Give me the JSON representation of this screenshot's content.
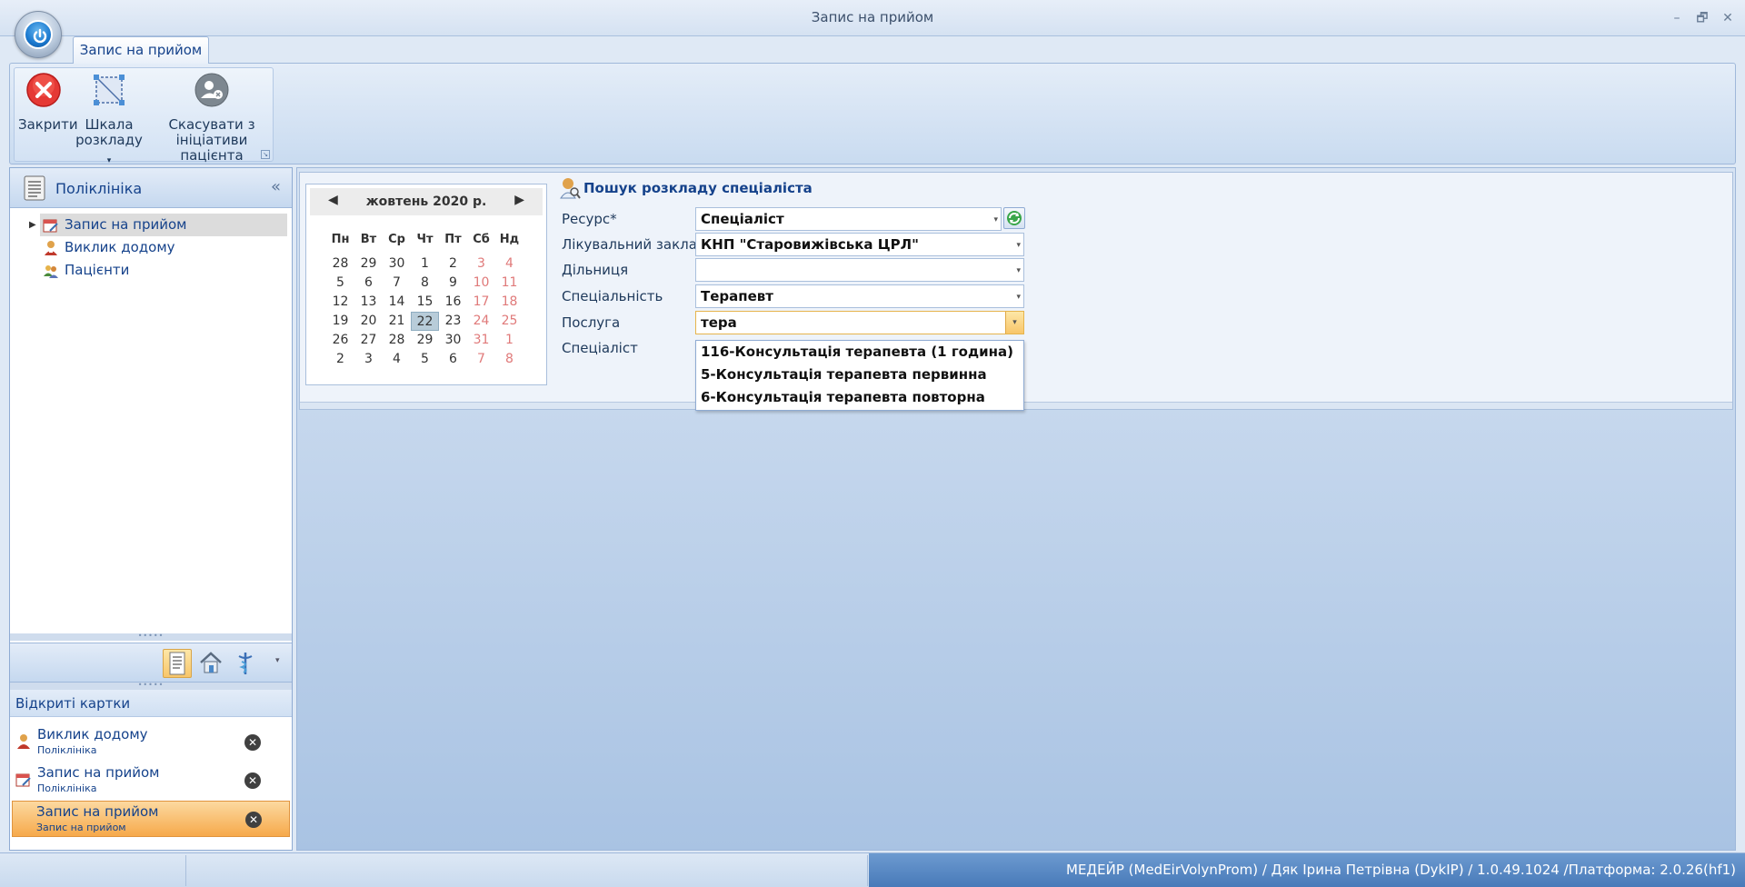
{
  "window": {
    "title": "Запис на прийом",
    "controls": {
      "minimize": "–",
      "restore": "🗗",
      "close": "✕"
    }
  },
  "ribbon": {
    "tab_label": "Запис на прийом",
    "buttons": {
      "close_label": "Закрити",
      "schedule_line1": "Шкала",
      "schedule_line2": "розкладу",
      "cancel_line1": "Скасувати з",
      "cancel_line2": "ініціативи пацієнта"
    }
  },
  "nav": {
    "title": "Поліклініка",
    "collapse_glyph": "«",
    "tree": [
      {
        "label": "Запис на прийом"
      },
      {
        "label": "Виклик додому"
      },
      {
        "label": "Пацієнти"
      }
    ],
    "splitter_glyph": "•••••"
  },
  "open_cards": {
    "title": "Відкриті картки",
    "cards": [
      {
        "name": "Виклик додому",
        "sub": "Поліклініка"
      },
      {
        "name": "Запис на прийом",
        "sub": "Поліклініка"
      },
      {
        "name": "Запис на прийом",
        "sub": "Запис на прийом"
      }
    ]
  },
  "calendar": {
    "month": "жовтень 2020 р.",
    "prev": "◀",
    "next": "▶",
    "weekdays": [
      "Пн",
      "Вт",
      "Ср",
      "Чт",
      "Пт",
      "Сб",
      "Нд"
    ],
    "weeks": [
      [
        "28",
        "29",
        "30",
        "1",
        "2",
        "3",
        "4"
      ],
      [
        "5",
        "6",
        "7",
        "8",
        "9",
        "10",
        "11"
      ],
      [
        "12",
        "13",
        "14",
        "15",
        "16",
        "17",
        "18"
      ],
      [
        "19",
        "20",
        "21",
        "22",
        "23",
        "24",
        "25"
      ],
      [
        "26",
        "27",
        "28",
        "29",
        "30",
        "31",
        "1"
      ],
      [
        "2",
        "3",
        "4",
        "5",
        "6",
        "7",
        "8"
      ]
    ],
    "today": "22"
  },
  "form": {
    "title": "Пошук розкладу спеціаліста",
    "labels": {
      "resource": "Ресурс*",
      "facility": "Лікувальний заклад",
      "district": "Дільниця",
      "specialty": "Спеціальність",
      "service": "Послуга",
      "specialist": "Спеціаліст"
    },
    "values": {
      "resource": "Спеціаліст",
      "facility": "КНП \"Старовижівська ЦРЛ\"",
      "district": "",
      "specialty": "Терапевт",
      "service": "тера"
    },
    "service_options": [
      "116-Консультація терапевта (1 година)",
      "5-Консультація терапевта первинна",
      "6-Консультація терапевта повторна"
    ],
    "dropdown_glyph": "▾"
  },
  "status": {
    "text": "МЕДЕЙР (MedEirVolynProm) / Дяк Ірина Петрівна (DykIP) / 1.0.49.1024 /Платформа: 2.0.26(hf1)"
  }
}
